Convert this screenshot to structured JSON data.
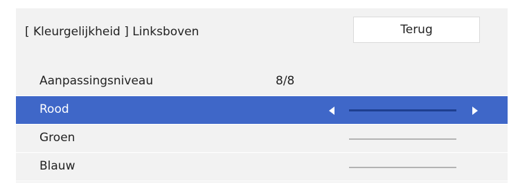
{
  "header": {
    "title": "[ Kleurgelijkheid ] Linksboven",
    "back_label": "Terug"
  },
  "rows": [
    {
      "label": "Aanpassingsniveau",
      "value": "8/8"
    },
    {
      "label": "Rood",
      "selected": true
    },
    {
      "label": "Groen"
    },
    {
      "label": "Blauw"
    }
  ],
  "colors": {
    "selected_row": "#3f67c8",
    "panel_bg": "#f2f2f2"
  },
  "icons": {
    "decrease": "triangle-left-icon",
    "increase": "triangle-right-icon"
  }
}
